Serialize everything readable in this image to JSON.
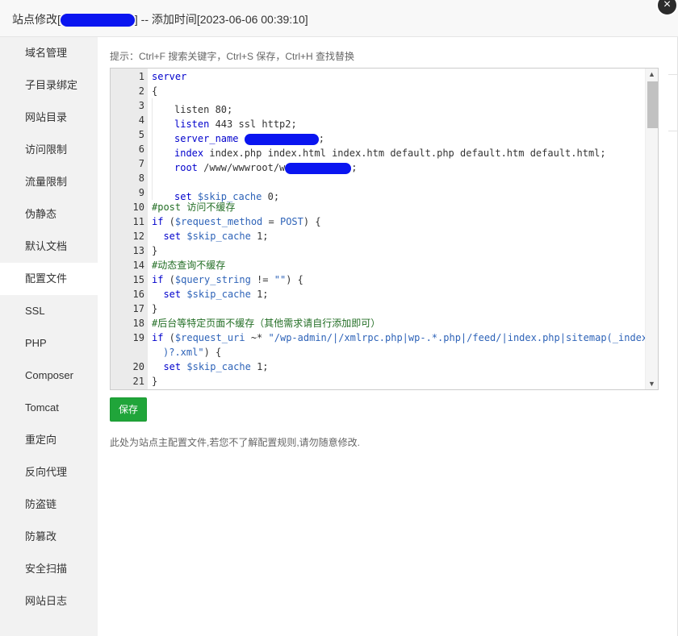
{
  "header": {
    "title_prefix": "站点修改[",
    "title_suffix": "] -- 添加时间[2023-06-06 00:39:10]",
    "close_symbol": "×"
  },
  "sidebar": {
    "items": [
      {
        "label": "域名管理"
      },
      {
        "label": "子目录绑定"
      },
      {
        "label": "网站目录"
      },
      {
        "label": "访问限制"
      },
      {
        "label": "流量限制"
      },
      {
        "label": "伪静态"
      },
      {
        "label": "默认文档"
      },
      {
        "label": "配置文件",
        "active": true
      },
      {
        "label": "SSL"
      },
      {
        "label": "PHP"
      },
      {
        "label": "Composer"
      },
      {
        "label": "Tomcat"
      },
      {
        "label": "重定向"
      },
      {
        "label": "反向代理"
      },
      {
        "label": "防盗链"
      },
      {
        "label": "防篡改"
      },
      {
        "label": "安全扫描"
      },
      {
        "label": "网站日志"
      }
    ]
  },
  "main": {
    "tip": "提示：Ctrl+F 搜索关键字，Ctrl+S 保存，Ctrl+H 查找替换",
    "save_label": "保存",
    "note": "此处为站点主配置文件,若您不了解配置规则,请勿随意修改."
  },
  "editor": {
    "line_numbers": [
      "1",
      "2",
      "3",
      "4",
      "5",
      "6",
      "7",
      "8",
      "9",
      "10",
      "11",
      "12",
      "13",
      "14",
      "15",
      "16",
      "17",
      "18",
      "19",
      "20",
      "21"
    ],
    "lines": {
      "l1": "server",
      "l2": "{",
      "l3": "listen 80;",
      "l4a": "listen",
      "l4b": " 443 ssl http2;",
      "l5a": "server_name",
      "l5b": ";",
      "l6a": "index",
      "l6b": " index.php index.html index.htm default.php default.htm default.html;",
      "l7a": "root",
      "l7b": " /www/wwwroot/w",
      "l7c": ";",
      "l9a": "set",
      "l9b": " $skip_cache",
      "l9c": " 0;",
      "l10": "#post 访问不缓存",
      "l11a": "if",
      "l11b": " (",
      "l11c": "$request_method",
      "l11d": " = ",
      "l11e": "POST",
      "l11f": ") {",
      "l12a": "set",
      "l12b": " $skip_cache",
      "l12c": " 1;",
      "l13": "}",
      "l14": "#动态查询不缓存",
      "l15a": "if",
      "l15b": " (",
      "l15c": "$query_string",
      "l15d": " != ",
      "l15e": "\"\"",
      "l15f": ") {",
      "l16a": "set",
      "l16b": " $skip_cache",
      "l16c": " 1;",
      "l17": "}",
      "l18": "#后台等特定页面不缓存（其他需求请自行添加即可）",
      "l19a": "if",
      "l19b": " (",
      "l19c": "$request_uri",
      "l19d": " ~* ",
      "l19e": "\"/wp-admin/|/xmlrpc.php|wp-.*.php|/feed/|index.php|sitemap(_index",
      "l19f": ")?.xml\"",
      "l19g": ") {",
      "l20a": "set",
      "l20b": " $skip_cache",
      "l20c": " 1;",
      "l21": "}"
    },
    "scroll_up": "▲",
    "scroll_down": "▼"
  },
  "colors": {
    "accent_green": "#20a53a",
    "redaction_blue": "#0a15f0",
    "keyword_blue": "#0000cc",
    "comment_green": "#236e25"
  }
}
